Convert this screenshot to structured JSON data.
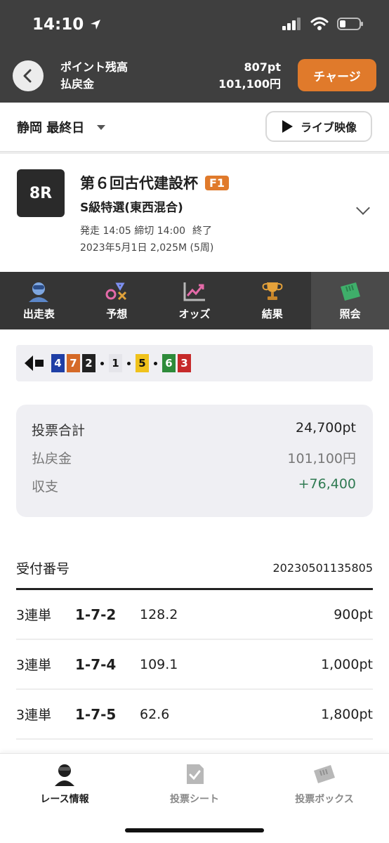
{
  "status": {
    "time": "14:10"
  },
  "header": {
    "points_label": "ポイント残高",
    "points_value": "807pt",
    "payout_label": "払戻金",
    "payout_value": "101,100円",
    "charge_label": "チャージ"
  },
  "venue": {
    "name": "静岡 最終日",
    "live_label": "ライブ映像"
  },
  "race": {
    "number": "8R",
    "title": "第６回古代建設杯",
    "grade": "F1",
    "subtitle": "S級特選(東西混合)",
    "schedule": "発走 14:05 締切 14:00",
    "state": "終了",
    "date_distance": "2023年5月1日 2,025M (5周)"
  },
  "tabs": [
    {
      "label": "出走表",
      "icon": "racer-icon"
    },
    {
      "label": "予想",
      "icon": "prediction-icon"
    },
    {
      "label": "オッズ",
      "icon": "odds-chart-icon"
    },
    {
      "label": "結果",
      "icon": "trophy-icon"
    },
    {
      "label": "照会",
      "icon": "ticket-icon",
      "active": true
    }
  ],
  "line": [
    {
      "car": "4",
      "color": "#1f3fa6"
    },
    {
      "car": "7",
      "color": "#d56a28"
    },
    {
      "car": "2",
      "color": "#222222"
    },
    {
      "sep": true
    },
    {
      "car": "1",
      "color": "#e5e5ea",
      "text": "#111111"
    },
    {
      "sep": true
    },
    {
      "car": "5",
      "color": "#f0c21c",
      "text": "#111111"
    },
    {
      "sep": true
    },
    {
      "car": "6",
      "color": "#2e8b3a"
    },
    {
      "car": "3",
      "color": "#c62a2a"
    }
  ],
  "summary": {
    "total_label": "投票合計",
    "total_value": "24,700pt",
    "payout_label": "払戻金",
    "payout_value": "101,100円",
    "balance_label": "収支",
    "balance_value": "+76,400"
  },
  "tickets": {
    "receipt_label": "受付番号",
    "receipt_number": "20230501135805",
    "rows": [
      {
        "type": "3連単",
        "combo": "1-7-2",
        "odds": "128.2",
        "amount": "900pt"
      },
      {
        "type": "3連単",
        "combo": "1-7-4",
        "odds": "109.1",
        "amount": "1,000pt"
      },
      {
        "type": "3連単",
        "combo": "1-7-5",
        "odds": "62.6",
        "amount": "1,800pt"
      }
    ]
  },
  "bottom_nav": [
    {
      "label": "レース情報",
      "active": true
    },
    {
      "label": "投票シート",
      "active": false
    },
    {
      "label": "投票ボックス",
      "active": false
    }
  ]
}
